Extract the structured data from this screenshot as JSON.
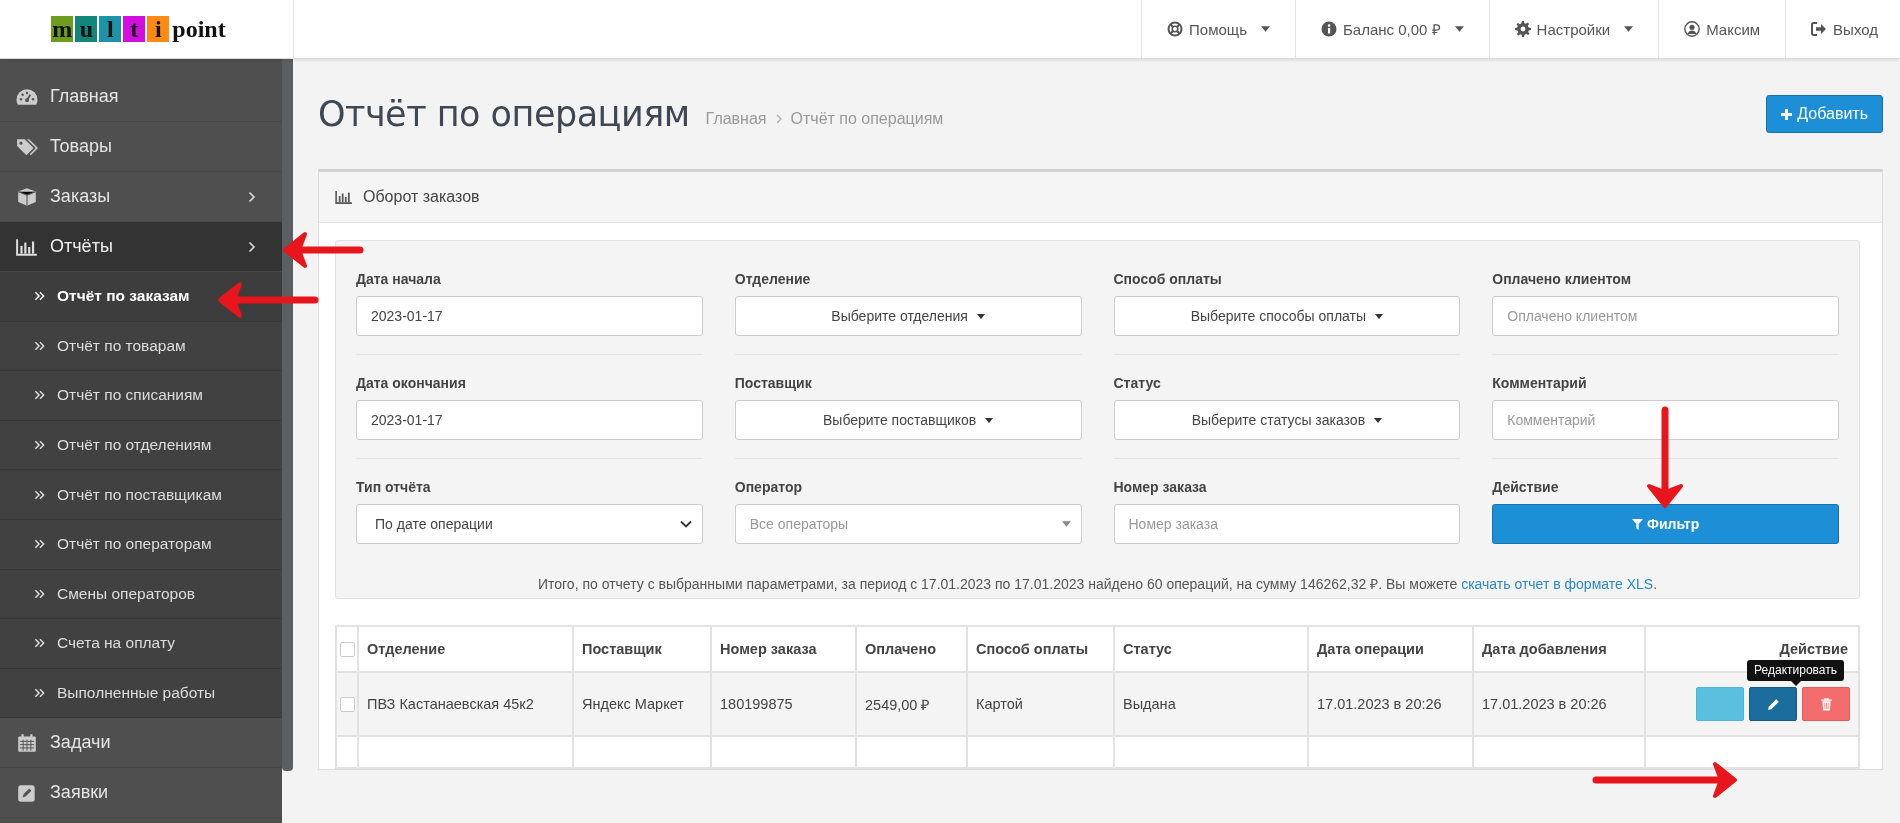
{
  "logo": {
    "letters": [
      {
        "char": "m",
        "color": "#6b9e1f"
      },
      {
        "char": "u",
        "color": "#12867a"
      },
      {
        "char": "l",
        "color": "#1c93a6"
      },
      {
        "char": "t",
        "color": "#d40ddf"
      },
      {
        "char": "i",
        "color": "#ff8a12"
      }
    ],
    "rest": "point"
  },
  "top_nav": [
    {
      "label": "Помощь",
      "dropdown": true
    },
    {
      "label": "Баланс 0,00 ₽",
      "dropdown": true
    },
    {
      "label": "Настройки",
      "dropdown": true
    },
    {
      "label": "Максим",
      "dropdown": false
    },
    {
      "label": "Выход",
      "dropdown": false
    }
  ],
  "sidebar": {
    "items": [
      {
        "label": "Главная",
        "expandable": false,
        "selected": false
      },
      {
        "label": "Товары",
        "expandable": false,
        "selected": false
      },
      {
        "label": "Заказы",
        "expandable": true,
        "selected": false
      },
      {
        "label": "Отчёты",
        "expandable": true,
        "selected": true,
        "children": [
          {
            "label": "Отчёт по заказам",
            "selected": true
          },
          {
            "label": "Отчёт по товарам",
            "selected": false
          },
          {
            "label": "Отчёт по списаниям",
            "selected": false
          },
          {
            "label": "Отчёт по отделениям",
            "selected": false
          },
          {
            "label": "Отчёт по поставщикам",
            "selected": false
          },
          {
            "label": "Отчёт по операторам",
            "selected": false
          },
          {
            "label": "Смены операторов",
            "selected": false
          },
          {
            "label": "Счета на оплату",
            "selected": false
          },
          {
            "label": "Выполненные работы",
            "selected": false
          }
        ]
      },
      {
        "label": "Задачи",
        "expandable": false,
        "selected": false
      },
      {
        "label": "Заявки",
        "expandable": false,
        "selected": false
      }
    ]
  },
  "page": {
    "title": "Отчёт по операциям",
    "breadcrumb": [
      "Главная",
      "Отчёт по операциям"
    ],
    "add_button": "Добавить"
  },
  "panel": {
    "title": "Оборот заказов",
    "filters": [
      {
        "label": "Дата начала",
        "kind": "input",
        "value": "2023-01-17"
      },
      {
        "label": "Отделение",
        "kind": "multiselect",
        "value": "Выберите отделения"
      },
      {
        "label": "Способ оплаты",
        "kind": "multiselect",
        "value": "Выберите способы оплаты"
      },
      {
        "label": "Оплачено клиентом",
        "kind": "input",
        "placeholder": "Оплачено клиентом"
      },
      {
        "label": "Дата окончания",
        "kind": "input",
        "value": "2023-01-17"
      },
      {
        "label": "Поставщик",
        "kind": "multiselect",
        "value": "Выберите поставщиков"
      },
      {
        "label": "Статус",
        "kind": "multiselect",
        "value": "Выберите статусы заказов"
      },
      {
        "label": "Комментарий",
        "kind": "input",
        "placeholder": "Комментарий"
      },
      {
        "label": "Тип отчёта",
        "kind": "select",
        "value": "По дате операции"
      },
      {
        "label": "Оператор",
        "kind": "combo",
        "placeholder": "Все операторы"
      },
      {
        "label": "Номер заказа",
        "kind": "input",
        "placeholder": "Номер заказа"
      },
      {
        "label": "Действие",
        "kind": "button",
        "value": "Фильтр"
      }
    ],
    "summary": {
      "text": "Итого, по отчету с выбранными параметрами, за период с 17.01.2023 по 17.01.2023 найдено 60 операций, на сумму 146262,32 ₽. Вы можете",
      "link": "скачать отчет в формате XLS",
      "end": "."
    }
  },
  "table": {
    "columns": [
      "Отделение",
      "Поставщик",
      "Номер заказа",
      "Оплачено",
      "Способ оплаты",
      "Статус",
      "Дата операции",
      "Дата добавления",
      "Действие"
    ],
    "header_checked": false,
    "rows": [
      {
        "checked": false,
        "cells": [
          "ПВЗ Кастанаевская 45к2",
          "Яндекс Маркет",
          "180199875",
          "2549,00 ₽",
          "Картой",
          "Выдана",
          "17.01.2023 в 20:26",
          "17.01.2023 в 20:26"
        ]
      }
    ]
  },
  "tooltip": "Редактировать"
}
